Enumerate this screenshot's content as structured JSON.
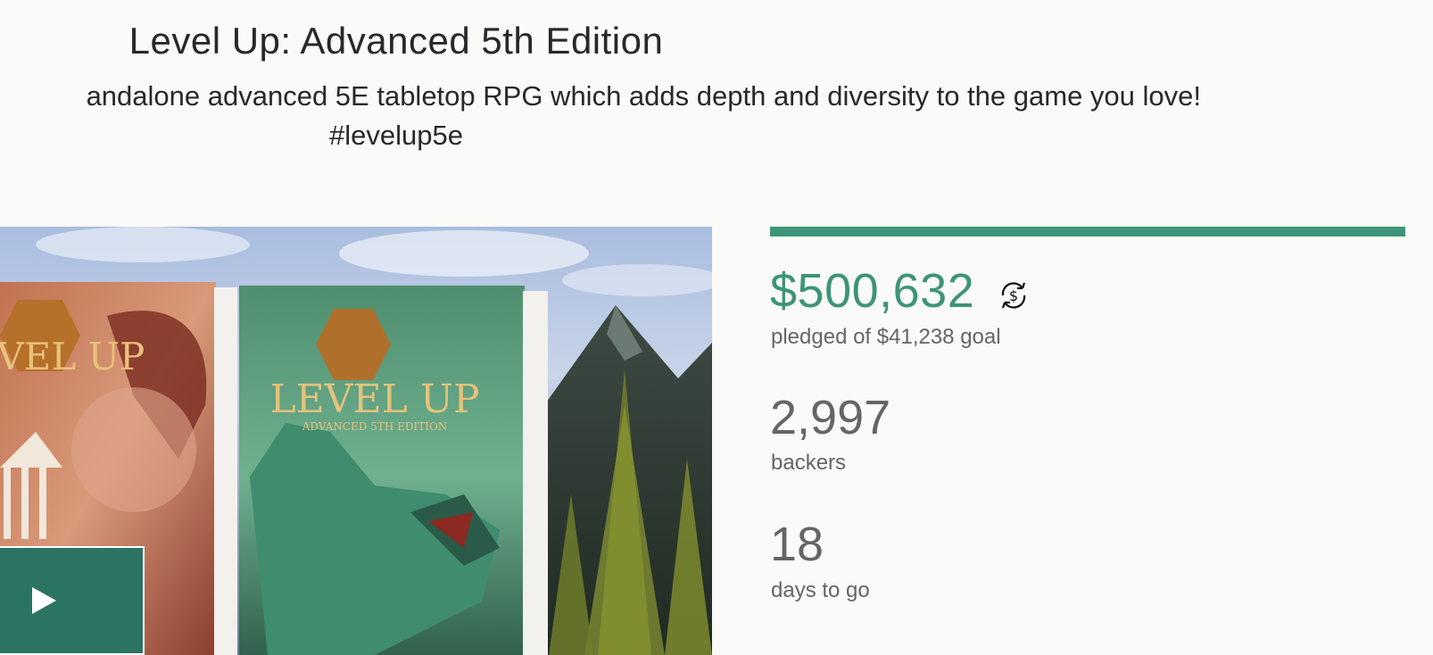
{
  "project": {
    "title": "Level Up: Advanced 5th Edition",
    "blurb": "andalone advanced 5E tabletop RPG which adds depth and diversity to the game you love!",
    "hashtag": "#levelup5e"
  },
  "media": {
    "play_icon": "play-icon",
    "book_cover_text": "LEVEL UP",
    "book_cover_subtext": "ADVANCED 5TH EDITION"
  },
  "stats": {
    "progress_fraction": 1.0,
    "accent_color": "#3d9478",
    "pledged_amount": "$500,632",
    "currency_icon": "currency-conversion-icon",
    "pledged_label": "pledged of $41,238 goal",
    "backers_count": "2,997",
    "backers_label": "backers",
    "days_count": "18",
    "days_label": "days to go"
  }
}
